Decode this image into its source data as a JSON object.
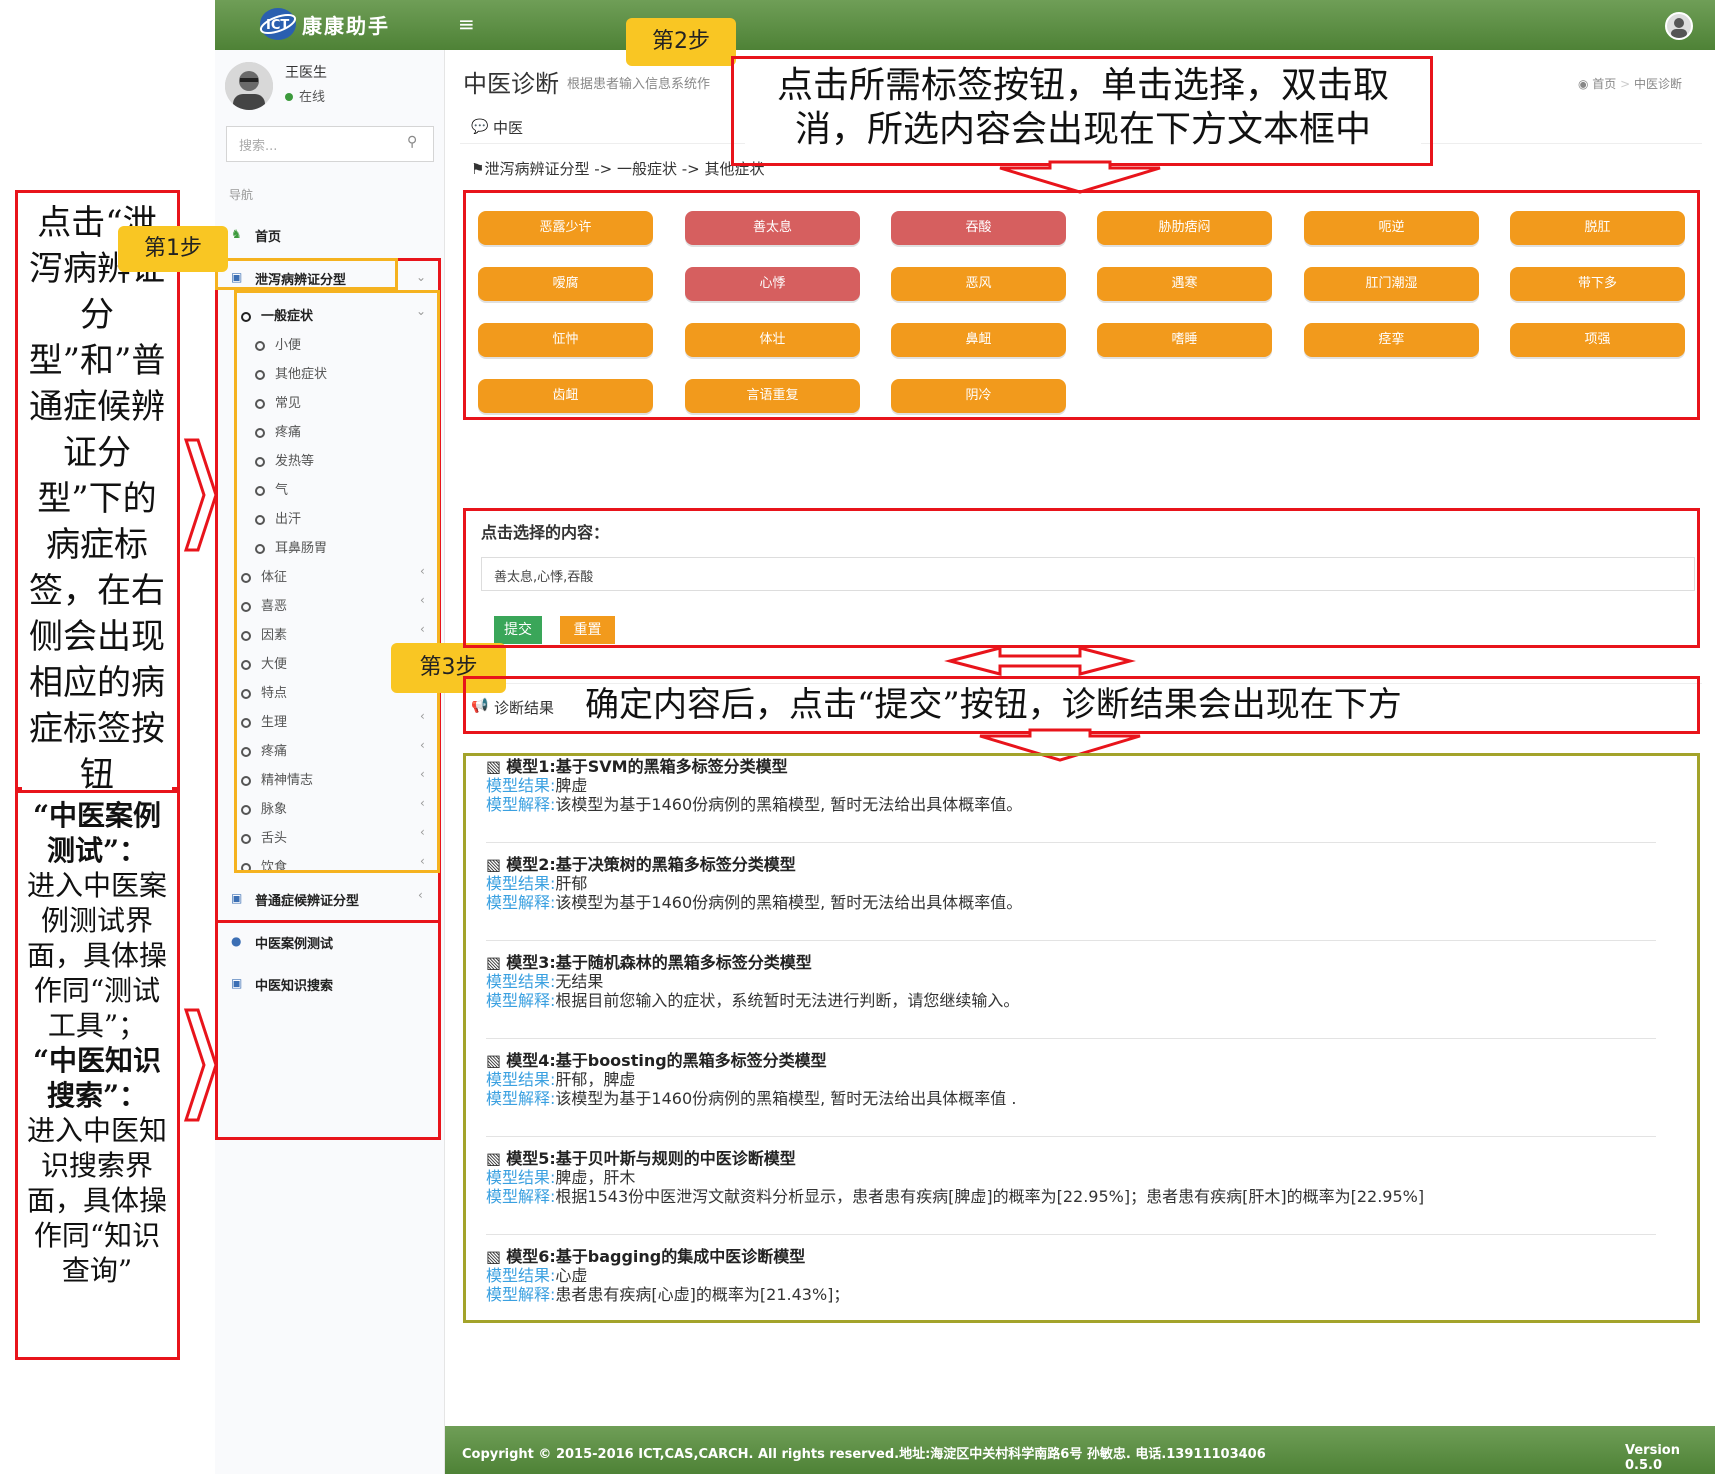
{
  "app": {
    "name": "康康助手",
    "menu_icon": "≡"
  },
  "user": {
    "name": "王医生",
    "status": "在线"
  },
  "search": {
    "placeholder": "搜索..."
  },
  "nav": {
    "header": "导航",
    "home": "首页",
    "diarrhea": "泄泻病辨证分型",
    "general_group": "一般症状",
    "sub_items": [
      "小便",
      "其他症状",
      "常见",
      "疼痛",
      "发热等",
      "气",
      "出汗",
      "耳鼻肠胃"
    ],
    "groups": [
      "体征",
      "喜恶",
      "因素",
      "大便",
      "特点",
      "生理",
      "疼痛",
      "精神情志",
      "脉象",
      "舌头",
      "饮食"
    ],
    "common": "普通症候辨证分型",
    "case_test": "中医案例测试",
    "knowledge": "中医知识搜索"
  },
  "page": {
    "title": "中医诊断",
    "subtitle": "根据患者输入信息系统作",
    "breadcrumb_home": "首页",
    "breadcrumb_sep": ">",
    "breadcrumb_current": "中医诊断",
    "panel_title": "中医",
    "path": "泄泻病辨证分型 ->  一般症状 -> 其他症状"
  },
  "tags": [
    {
      "label": "恶露少许",
      "state": "normal"
    },
    {
      "label": "善太息",
      "state": "selected"
    },
    {
      "label": "吞酸",
      "state": "selected"
    },
    {
      "label": "胁肋痞闷",
      "state": "normal"
    },
    {
      "label": "呃逆",
      "state": "normal"
    },
    {
      "label": "脱肛",
      "state": "normal"
    },
    {
      "label": "嗳腐",
      "state": "normal"
    },
    {
      "label": "心悸",
      "state": "selected"
    },
    {
      "label": "恶风",
      "state": "normal"
    },
    {
      "label": "遇寒",
      "state": "normal"
    },
    {
      "label": "肛门潮湿",
      "state": "normal"
    },
    {
      "label": "带下多",
      "state": "normal"
    },
    {
      "label": "怔忡",
      "state": "normal"
    },
    {
      "label": "体壮",
      "state": "normal"
    },
    {
      "label": "鼻衄",
      "state": "normal"
    },
    {
      "label": "嗜睡",
      "state": "normal"
    },
    {
      "label": "痉挛",
      "state": "normal"
    },
    {
      "label": "项强",
      "state": "normal"
    },
    {
      "label": "齿衄",
      "state": "normal"
    },
    {
      "label": "言语重复",
      "state": "normal"
    },
    {
      "label": "阴冷",
      "state": "normal"
    }
  ],
  "selection": {
    "label": "点击选择的内容：",
    "value": "善太息,心悸,吞酸",
    "submit": "提交",
    "reset": "重置"
  },
  "results": {
    "title": "诊断结果",
    "result_label": "模型结果:",
    "explain_label": "模型解释:",
    "models": [
      {
        "title": "模型1:基于SVM的黑箱多标签分类模型",
        "result": "脾虚",
        "explain": "该模型为基于1460份病例的黑箱模型, 暂时无法给出具体概率值。"
      },
      {
        "title": "模型2:基于决策树的黑箱多标签分类模型",
        "result": "肝郁",
        "explain": "该模型为基于1460份病例的黑箱模型, 暂时无法给出具体概率值。"
      },
      {
        "title": "模型3:基于随机森林的黑箱多标签分类模型",
        "result": "无结果",
        "explain": "根据目前您输入的症状，系统暂时无法进行判断，请您继续输入。"
      },
      {
        "title": "模型4:基于boosting的黑箱多标签分类模型",
        "result": "肝郁，脾虚",
        "explain": "该模型为基于1460份病例的黑箱模型, 暂时无法给出具体概率值 ."
      },
      {
        "title": "模型5:基于贝叶斯与规则的中医诊断模型",
        "result": "脾虚，肝木",
        "explain": "根据1543份中医泄泻文献资料分析显示，患者患有疾病[脾虚]的概率为[22.95%]；患者患有疾病[肝木]的概率为[22.95%]"
      },
      {
        "title": "模型6:基于bagging的集成中医诊断模型",
        "result": "心虚",
        "explain": "患者患有疾病[心虚]的概率为[21.43%]；"
      }
    ]
  },
  "footer": {
    "text": "Copyright © 2015-2016 ICT,CAS,CARCH. All rights reserved.地址:海淀区中关村科学南路6号 孙敏忠. 电话.13911103406",
    "version": "Version 0.5.0"
  },
  "annotations": {
    "step1": "第1步",
    "step2": "第2步",
    "step3": "第3步",
    "left_top": "点击“泄泻病辨证分型”和”普通症候辨证分型”下的病症标签，在右侧会出现相应的病症标签按钮",
    "left_bottom_1_title": "“中医案例测试”：",
    "left_bottom_1_body": "进入中医案例测试界面，具体操作同“测试工具”；",
    "left_bottom_2_title": "“中医知识搜索”：",
    "left_bottom_2_body": "进入中医知识搜索界面，具体操作同“知识查询”",
    "top_callout": "点击所需标签按钮，单击选择，双击取消，所选内容会出现在下方文本框中",
    "mid_callout": "确定内容后，点击“提交”按钮，诊断结果会出现在下方"
  },
  "colors": {
    "tag_normal": "#f29a1c",
    "tag_selected": "#d65f5f",
    "header_green": "#5a8f42",
    "annotation_red": "#e8141b",
    "step_yellow": "#f9c623"
  }
}
